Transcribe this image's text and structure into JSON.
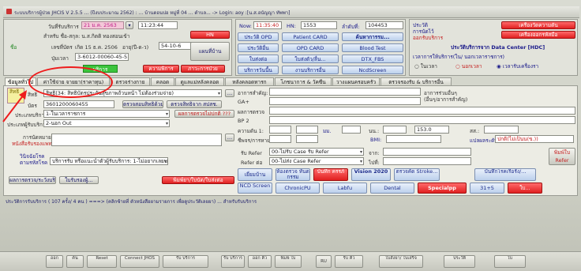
{
  "window": {
    "title": "ระบบบริการผู้ป่วย JHCIS V 2.5.5 ... (ปีงบประมาณ 2562) : ... บ้านดอนปอ หมู่ที่ 04 ... ตำบล... -> Login: aoy :[น.ส.อนัญญา ทัพพา]"
  },
  "header": {
    "date_label": "วันที่รับบริการ",
    "date_value": "21 ม.ค. 2563",
    "time_value": "11:23:44",
    "btn_hn": "HN",
    "text_prefix": "ชื่อ",
    "name_row": "สำหรับ ชื่อ-สกุล: น.ส.กิตติ ทองสอนเข้า",
    "id_label": "เลขที่บัตร",
    "birth": "เกิด 15 ธ.ค. 2506",
    "age": "อายุ(ปี-ด-ว)",
    "age_value": "54-10-6",
    "phone_label": "ปุ่มเวลา",
    "card_id": "3-6012-00060-45-5",
    "btn_patient_map": "แผนที่บ้าน",
    "tag_green": "บริการ",
    "tag_red1": "ความพิการ",
    "tag_red2": "ภาวะการป่วย",
    "now_label": "Now:",
    "now_time": "11:35:40",
    "hn_label": "HN:",
    "hn_value": "1553",
    "queue_label": "ลำดับที่:",
    "queue_value": "104453",
    "btn_opd": "ประวัติ OPD",
    "btn_patient_card": "Patient CARD",
    "btn_search": "ค้นหาการรม...",
    "btn_history": "ประวัติอื่น",
    "btn_opd_card": "OPD CARD",
    "btn_blood": "Blood Test",
    "btn_refer": "ใบส่งต่อ",
    "btn_ins": "ใบส่งตัว/ลื่น...",
    "btn_dtx": "DTX_FBS",
    "btn_service_ok": "บริการวันนี้น",
    "btn_follow": "งานบริการอื่น",
    "btn_ncd": "NcdScreen",
    "right_label1": "ประวัติ",
    "right_label2": "การนัดไว้",
    "right_label3": "ออกรับบริการ",
    "btn_right1": "เครื่องวัดความดัน",
    "btn_right2": "เครื่องออกรหัสมือ",
    "hdc_label": "ประวัติบริการจาก Data Center [HDC]",
    "svc_time_label": "เวลาการให้บริการ(ใน/ นอกเวลาราชการ)",
    "radio_in": "ในเวลา",
    "radio_out": "นอกเวลา",
    "radio_auto": "เวลารับเครื่องรา"
  },
  "tabs": [
    {
      "label": "ข้อมูลทั่วไป"
    },
    {
      "label": "ค่าใช้จ่าย จายยา(ราคาทุน)"
    },
    {
      "label": "ตรวจร่างกาย"
    },
    {
      "label": "คลอด"
    },
    {
      "label": "ดูแลแม่หลังคลอด"
    },
    {
      "label": "หลังคลอดทารก"
    },
    {
      "label": "โภชนาการ & วัคซีน"
    },
    {
      "label": "วางแผนครอบครัว"
    },
    {
      "label": "ตรวจรองรับ & บริการอื่น"
    }
  ],
  "form": {
    "pay_label": "สิทธิ",
    "pay_value": "สิทธิ(34: สิทธิบัตรประกันสุขภาพถ้วนหน้า ไม่ต้องร่วมจ่าย)",
    "card_no_label": "บัตร",
    "card_no_value": "3601200060455",
    "btn_check_rights": "ตรวจสิทธิจาก สปสช.",
    "smart_note": "ตรวจสอบสิทธิด้วยSmartCard",
    "visit_type_label": "ประเภทบริการ",
    "visit_type_value": "1-ในเวลาราชการ",
    "btn_screen": "ผลการตรวจไม่ปกติ ???",
    "service_place_label": "ประเภทผู้รับบริการ",
    "service_place_value": "2-นอก Out",
    "complaint_label": "อาการสำคัญ:",
    "ga_label": "GA+",
    "history_label": "ผลการตรวจ",
    "bp_label": "BP 2",
    "temp_label": "ความดัน 1:",
    "unit1": "มม.",
    "pulse_label": "ชีพจร/การหายใจ:",
    "weight_label": "นน.:",
    "weight_value": "153.0",
    "height_label": "สส.:",
    "bmi_label": "BMI:",
    "bmi_text": "แปลผลระดับ",
    "bmi_value": "ปกติ(ไม่เป็นน(ข.))",
    "symptom2_label": "อาการร่วมอื่นๆ",
    "symptom2_sub": "(อื่นๆ/อาการสำคัญ)",
    "appt_label": "การนัดหมาย",
    "appt_sub": "หนังสือรับรองแพทย์",
    "refer_in_label": "รับ Refer",
    "refer_in_value": "00-ไม่รับ Case รับ Refer",
    "refer_out_label": "Refer ต่อ",
    "refer_out_value": "00-ไม่ส่ง Case Refer",
    "refer_from_label": "จาก:",
    "refer_to_label": "ไปที่:",
    "btn_print_refer": "พิมพ์ใบ Refer",
    "diag_label": "วินิจฉัยโรค",
    "diag_sub": "ตามรหัสโรค",
    "service_detail": "บริการรับ หรือแนะนำตัวผู้รับบริการ: 1-ไม่อยากเลยบริการ",
    "btn_screening": "เยี่ยมบ้าน",
    "btn_dental": "ห้องตรวจ ทันตกรรม",
    "btn_preg": "บันทึก ครรภ์",
    "btn_vision": "Vision 2020",
    "btn_stroke": "ตรวจคัด Stroke...",
    "btn_save_disease": "บันทึกโรคเรื้อรัง/...",
    "btn_service_diag": "ผลการตรวจ/ระวังบริ",
    "btn_print_diag": "ใบรับรองผู้...",
    "btn_prescribe": "พิมพ์ยา/ใบนัด/ใบส่งต่อ",
    "btn_ncd": "NCD Screen",
    "btn_chronic": "ChronicPU",
    "btn_labfu": "Labfu",
    "btn_dental2": "Dental",
    "btn_specialpp": "Specialpp",
    "btn_3115": "31+5",
    "btn_last": "ใบ...",
    "status_line": "ประวัติการรับบริการ ( 107 ครั้ง/ 4 คน ) ===> (คลิกซ้ายที่ ตัวหนังสือยามรายการ เพื่อดูประวัติเลยยา) ... สำหรับรับบริการ"
  },
  "taskbar": [
    {
      "label": "ออก"
    },
    {
      "label": "ค้น"
    },
    {
      "label": "Reset"
    },
    {
      "label": "Connect JHOS"
    },
    {
      "label": "รับ บริการ"
    },
    {
      "label": "รับ บริการ"
    },
    {
      "label": "ออก คิว"
    },
    {
      "label": "พิมพ์ ใบ"
    },
    {
      "label": "RU"
    },
    {
      "label": "รับ คิว"
    },
    {
      "label": "ใบสั่งยา/ ใบเสร็จ"
    },
    {
      "label": "ประวัติ"
    },
    {
      "label": "ใบ"
    }
  ]
}
